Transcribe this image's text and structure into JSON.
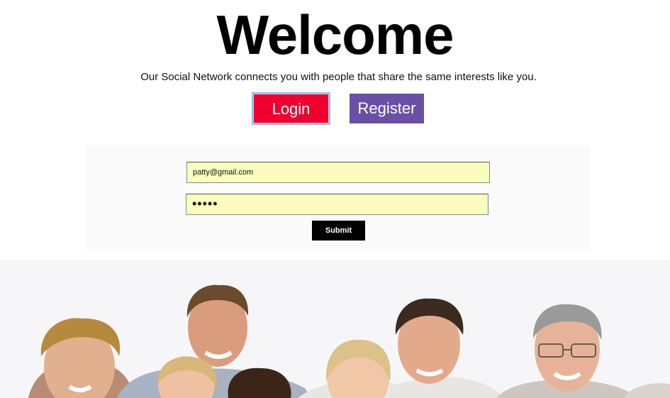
{
  "header": {
    "title": "Welcome",
    "subtitle": "Our Social Network connects you with people that share the same interests like you."
  },
  "nav": {
    "login_label": "Login",
    "register_label": "Register"
  },
  "login_form": {
    "email_value": "patty@gmail.com",
    "password_value": "•••••",
    "submit_label": "Submit"
  },
  "colors": {
    "login_button": "#f0002e",
    "register_button": "#6a4fa6",
    "field_background": "#fafdbb",
    "submit_button": "#000000"
  },
  "hero_image": {
    "people_count": 8
  }
}
